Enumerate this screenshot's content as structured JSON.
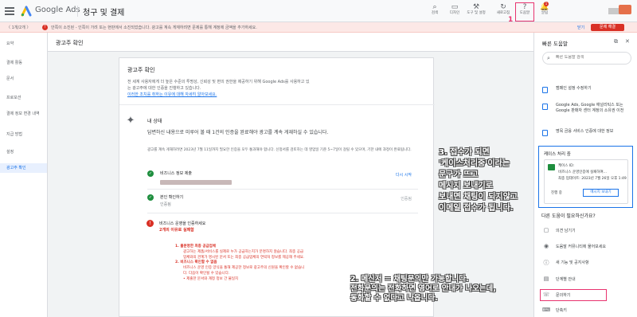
{
  "topbar": {
    "brand": "Google Ads",
    "title": "청구 및 결제",
    "tools": [
      {
        "icon": "search-icon",
        "glyph": "⌕",
        "label": "검색"
      },
      {
        "icon": "appearance-icon",
        "glyph": "▭",
        "label": "디자인"
      },
      {
        "icon": "tools-icon",
        "glyph": "⚒",
        "label": "도구 및 설정"
      },
      {
        "icon": "refresh-icon",
        "glyph": "↻",
        "label": "새로고침"
      },
      {
        "icon": "help-icon",
        "glyph": "?",
        "label": "도움말"
      },
      {
        "icon": "bell-icon",
        "glyph": "🔔",
        "label": "알림"
      }
    ],
    "badge": "1",
    "help_mark": "1"
  },
  "alert": {
    "nav": "〈 1개/2개 〉",
    "text": "안쪽이 소진된 - 인쪽이 가려 또는 현판에서 소진되었습니다. 광고를 계속 게재하려면 문제를 통해 계정에 금액을 추가하세요.",
    "dismiss": "닫기",
    "action": "문제 해결"
  },
  "leftnav": [
    {
      "label": "요약",
      "active": false
    },
    {
      "label": "결제 활동",
      "active": false
    },
    {
      "label": "문서",
      "active": false
    },
    {
      "label": "프로모션",
      "active": false
    },
    {
      "label": "결제 정보 변경 내역",
      "active": false
    },
    {
      "label": "지급 방법",
      "active": false
    },
    {
      "label": "설정",
      "active": false
    },
    {
      "label": "광고주 확인",
      "active": true
    }
  ],
  "page_title": "광고주 확인",
  "card": {
    "title": "광고주 확인",
    "desc": "전 세계 사용자에게 더 높은 수준의 투명성, 신뢰성 및 편의 권한을 제공하기 위해 Google Ads를 사용하고 있는 광고주에 대한 인증을 진행하고 있습니다.",
    "link": "이러한 조치를 취하는 이유에 대해 자세히 알아보세요.",
    "status_title": "내 상태",
    "status_desc": "답변하신 내용으로 미루어 볼 때 1건의 인증을 완료해야 광고를 계속 게재하실 수 있습니다.",
    "status_long": "광고를 계속 게재하려면 2023년 7월 11일까지 필요한 인증을 모두 통과해야 합니다. 신청서를 검토하는 데 영업일 기준 5~7일이 걸릴 수 있으며, 기한 내에 과정이 완료됩니다.",
    "steps": [
      {
        "title": "비즈니스 정보 제출",
        "sub": "",
        "action": "다시 시작",
        "status": "ok"
      },
      {
        "title": "본인 확인하기",
        "sub": "인증됨",
        "action": "인증됨",
        "status": "ok"
      }
    ],
    "fail_title": "비즈니스 운영을 인증하세요",
    "fail_sub": "2개의 이유로 실패함",
    "reasons": [
      {
        "h": "1. 불분명한 최종 공급업체",
        "b": "광고하는 제품/서비스를 실제로 누가 공급하는지가 분명하지 않습니다. 최종 공급업체와의 관계가 명시된 문서 또는 최종 공급업체의 연락처 정보를 제공해 주세요."
      },
      {
        "h": "2. 비즈니스 확인할 수 없음",
        "b": "비즈니스 운영 인증 양식을 통해 제공한 정보로 광고주의 신원을 확인할 수 없습니다. 다음이 확인될 수 있습니다."
      },
      {
        "h": "",
        "b": "• 제출한 문서와 계정 정보 간 불일치"
      },
      {
        "h": "",
        "b": "• 누락된 문서"
      },
      {
        "h": "",
        "b": "• 제출된 파일 관련 문제(예: 흐리거나 반사되는 이미지가 포함)"
      }
    ]
  },
  "annotations": {
    "a3": [
      "3. 접수가 되면",
      "'케이스처리중'이라는",
      "문구가 뜨고",
      "메시지 보내기로",
      "보내면 채팅이 되지않고",
      "이메일 접수가 됩니다."
    ],
    "a2": [
      "2. 메신저 = 채팅문의만 가능합니다.",
      "전화문의는 전화하면 영어로 안내가 나오는데,",
      "동화할 수 없다고 나옵니다."
    ]
  },
  "help_panel": {
    "title": "빠른 도움말",
    "search_placeholder": "빠른 도움말 검색",
    "articles": [
      "캠페인 설정 수정하기",
      "Google Ads, Google 애널리틱스 또는 Google 판매자 센터 계정의 소유권 이전",
      "명목 금융 서비스 인증에 대한 정보"
    ],
    "case": {
      "title": "케이스 처리 중",
      "lines": [
        "케이스 ID:",
        "비즈니스 운영인증에 실패하여...",
        "최종 업데이트: 2023년 7월 26일 오후 1:49",
        "진행 중"
      ],
      "send": "메시지 보내기"
    },
    "question": "다른 도움이 필요하신가요?",
    "links": [
      {
        "icon": "chat-icon",
        "glyph": "▢",
        "label": "의견 남기기"
      },
      {
        "icon": "community-icon",
        "glyph": "◉",
        "label": "도움말 커뮤니티에 물어보세요"
      },
      {
        "icon": "info-icon",
        "glyph": "ⓘ",
        "label": "새 기능 및 공지사항"
      },
      {
        "icon": "guide-icon",
        "glyph": "▤",
        "label": "단계별 안내"
      },
      {
        "icon": "phone-icon",
        "glyph": "☏",
        "label": "문의하기"
      },
      {
        "icon": "shortcut-icon",
        "glyph": "⌨",
        "label": "단축키"
      }
    ]
  }
}
